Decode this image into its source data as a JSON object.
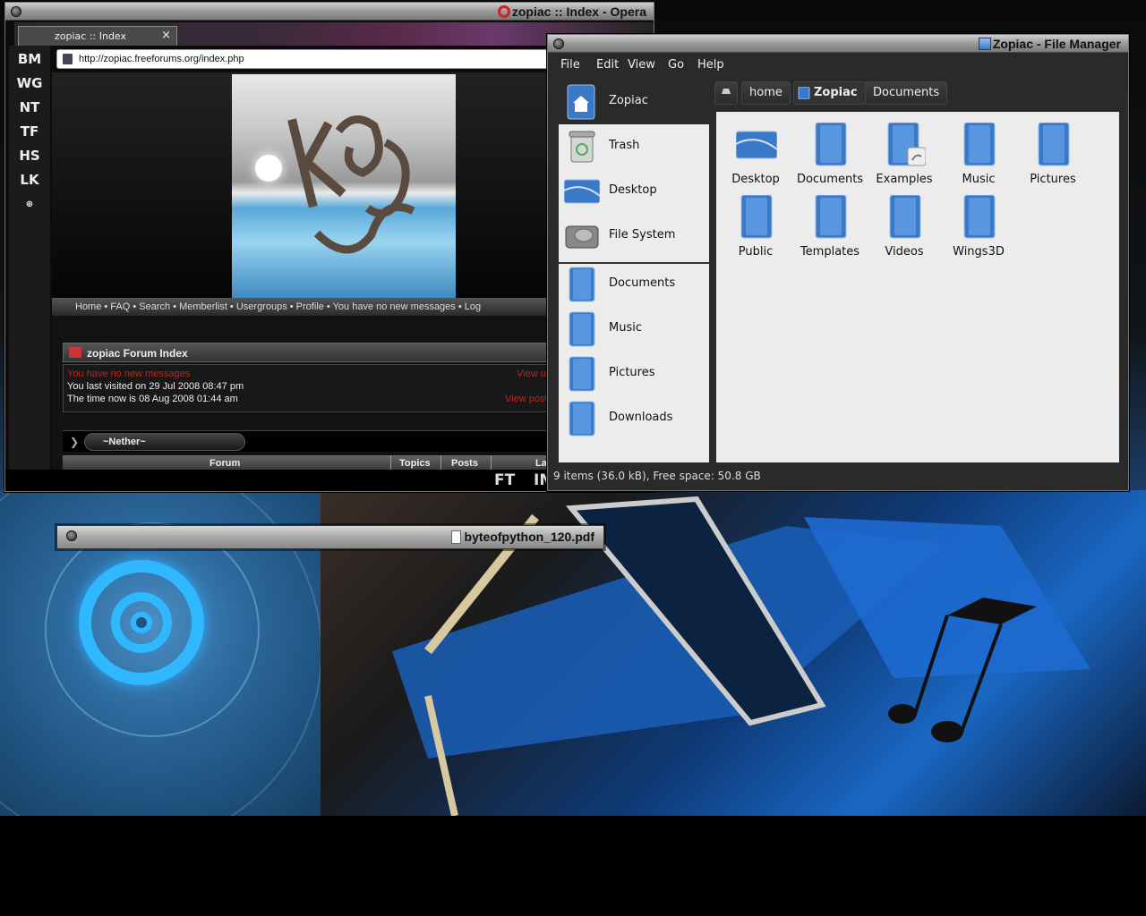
{
  "opera": {
    "title": "zopiac :: Index - Opera",
    "tab_label": "zopiac :: Index",
    "tab_close": "×",
    "url": "http://zopiac.freeforums.org/index.php",
    "panels": [
      "BM",
      "WG",
      "NT",
      "TF",
      "HS",
      "LK"
    ],
    "nav": "Home  •  FAQ  •  Search  •  Memberlist  •  Usergroups  •  Profile  •  You have no new messages  •  Log",
    "forum_index_title": "zopiac Forum Index",
    "no_new_messages": "You have no new messages",
    "last_visited": "You last visited on 29 Jul 2008 08:47 pm",
    "time_now": "The time now is 08 Aug 2008 01:44 am",
    "view_unanswered": "View un",
    "view_posts": "View post",
    "category": "~Nether~",
    "columns": [
      "Forum",
      "Topics",
      "Posts",
      "Las"
    ],
    "status_ft": "FT",
    "status_im": "IM"
  },
  "file_manager": {
    "title": "Zopiac - File Manager",
    "menu": [
      "File",
      "Edit",
      "View",
      "Go",
      "Help"
    ],
    "places": [
      {
        "label": "Zopiac",
        "icon": "home-folder-icon",
        "selected": true
      },
      {
        "label": "Trash",
        "icon": "trash-icon"
      },
      {
        "label": "Desktop",
        "icon": "desktop-icon"
      },
      {
        "label": "File System",
        "icon": "harddisk-icon"
      }
    ],
    "bookmarks": [
      {
        "label": "Documents",
        "icon": "folder-icon"
      },
      {
        "label": "Music",
        "icon": "folder-icon"
      },
      {
        "label": "Pictures",
        "icon": "folder-icon"
      },
      {
        "label": "Downloads",
        "icon": "folder-icon"
      }
    ],
    "path": [
      "home",
      "Zopiac",
      "Documents"
    ],
    "items": [
      {
        "label": "Desktop",
        "icon": "desktop-icon"
      },
      {
        "label": "Documents",
        "icon": "folder-icon"
      },
      {
        "label": "Examples",
        "icon": "folder-link-icon"
      },
      {
        "label": "Music",
        "icon": "folder-icon"
      },
      {
        "label": "Pictures",
        "icon": "folder-icon"
      },
      {
        "label": "Public",
        "icon": "folder-icon"
      },
      {
        "label": "Templates",
        "icon": "folder-icon"
      },
      {
        "label": "Videos",
        "icon": "folder-icon"
      },
      {
        "label": "Wings3D",
        "icon": "folder-icon"
      }
    ],
    "status": "9 items (36.0 kB), Free space: 50.8 GB"
  },
  "pdf_window": {
    "title": "byteofpython_120.pdf"
  },
  "colors": {
    "accent_blue": "#3a78c8",
    "forum_red": "#c0241a"
  }
}
